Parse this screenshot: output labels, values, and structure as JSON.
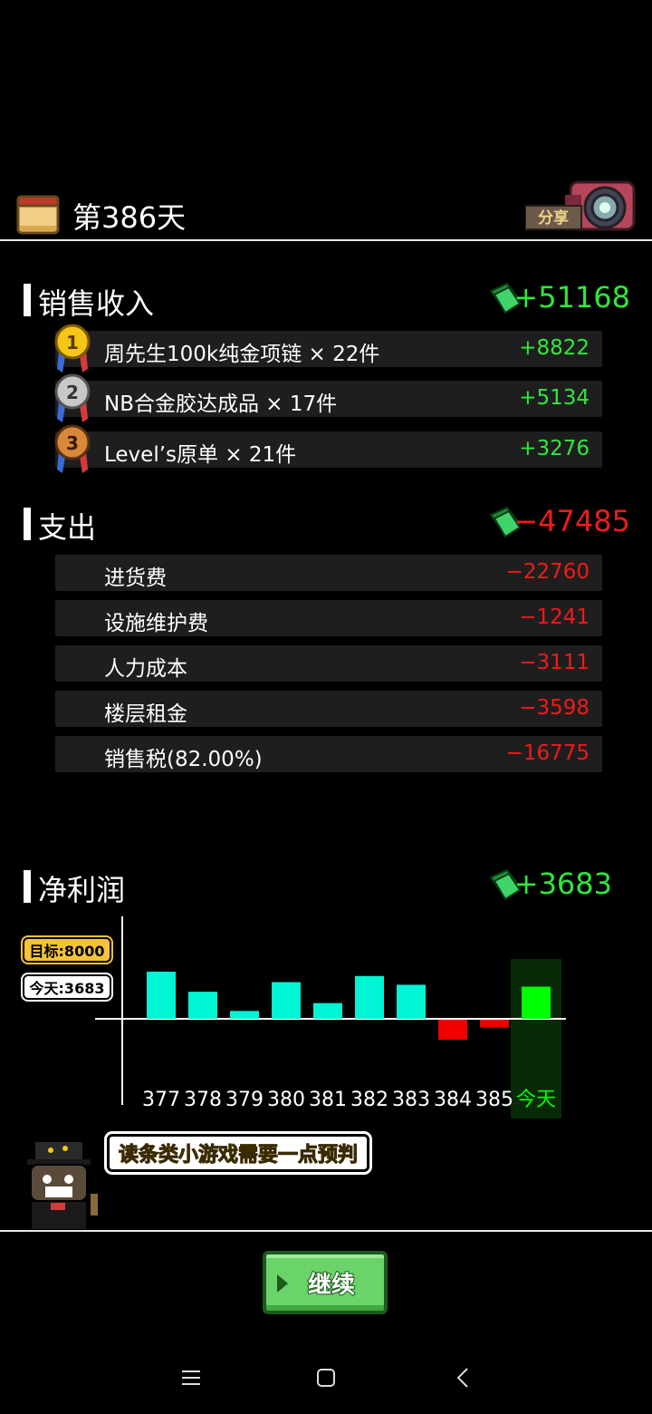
{
  "header": {
    "day_title": "第386天",
    "share_label": "分享"
  },
  "sales": {
    "title": "销售收入",
    "total": "+51168",
    "items": [
      {
        "rank": "1",
        "label": "周先生100k纯金项链 × 22件",
        "value": "+8822"
      },
      {
        "rank": "2",
        "label": "NB合金胶达成品 × 17件",
        "value": "+5134"
      },
      {
        "rank": "3",
        "label": "Level’s原单 × 21件",
        "value": "+3276"
      }
    ]
  },
  "expenses": {
    "title": "支出",
    "total": "−47485",
    "items": [
      {
        "label": "进货费",
        "value": "−22760"
      },
      {
        "label": "设施维护费",
        "value": "−1241"
      },
      {
        "label": "人力成本",
        "value": "−3111"
      },
      {
        "label": "楼层租金",
        "value": "−3598"
      },
      {
        "label": "销售税(82.00%)",
        "value": "−16775"
      }
    ]
  },
  "profit": {
    "title": "净利润",
    "total": "+3683",
    "target_tag": "目标:8000",
    "today_tag": "今天:3683"
  },
  "chart_data": {
    "type": "bar",
    "categories": [
      "377",
      "378",
      "379",
      "380",
      "381",
      "382",
      "383",
      "384",
      "385",
      "今天"
    ],
    "values": [
      5400,
      3100,
      900,
      4200,
      1800,
      4900,
      3900,
      -2300,
      -900,
      3683
    ],
    "target": 8000,
    "colors": {
      "positive": "#00f5d4",
      "negative": "#f00000",
      "today": "#00ff00",
      "today_bg": "#062a06"
    }
  },
  "tip": {
    "text": "读条类小游戏需要一点预判"
  },
  "continue": {
    "label": "继续"
  },
  "colors": {
    "positive": "#2ee83a",
    "negative": "#f01a1a",
    "row_bg": "#1e1e1e"
  }
}
